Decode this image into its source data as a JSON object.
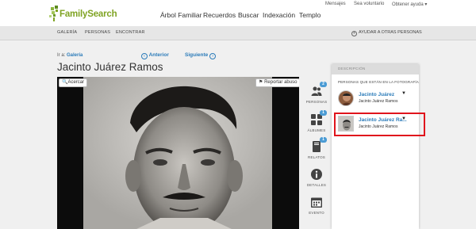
{
  "header": {
    "logo_text": "FamilySearch",
    "util_links": [
      "Mensajes",
      "Sea voluntario",
      "Obtener ayuda ▾"
    ],
    "nav": [
      "Árbol Familiar",
      "Recuerdos",
      "Buscar",
      "Indexación",
      "Templo"
    ]
  },
  "subnav": {
    "items": [
      "GALERÍA",
      "PERSONAS",
      "ENCONTRAR"
    ],
    "right": "AYUDAR A OTRAS PERSONAS"
  },
  "breadcrumb": {
    "prefix": "Ir a:",
    "link": "Galería"
  },
  "pager": {
    "prev": "Anterior",
    "next": "Siguiente"
  },
  "page_title": "Jacinto Juárez Ramos",
  "photo": {
    "zoom_label": "🔍Acercar",
    "report_label": "Reportar abuso"
  },
  "rail": [
    {
      "label": "PERSONAS",
      "icon": "people-icon",
      "badge": "2"
    },
    {
      "label": "ÁLBUMES",
      "icon": "albums-grid-icon",
      "badge": "1"
    },
    {
      "label": "RELATOS",
      "icon": "book-icon",
      "badge": "1"
    },
    {
      "label": "DETALLES",
      "icon": "info-icon",
      "badge": ""
    },
    {
      "label": "EVENTO",
      "icon": "calendar-icon",
      "badge": ""
    }
  ],
  "panel": {
    "header": "DESCRIPCIÓN",
    "caption": "PERSONAS QUE ESTÁN EN LA FOTOGRAFÍA",
    "people": [
      {
        "name": "Jacinto Juárez",
        "sub": "Jacinto Juárez Ramos"
      },
      {
        "name": "Jacinto Juárez Ra...",
        "sub": "Jacinto Juárez Ramos"
      }
    ]
  },
  "colors": {
    "brand": "#7fa323",
    "link": "#2b7bb9",
    "badge": "#4a9bd4",
    "highlight": "#e0141c"
  }
}
